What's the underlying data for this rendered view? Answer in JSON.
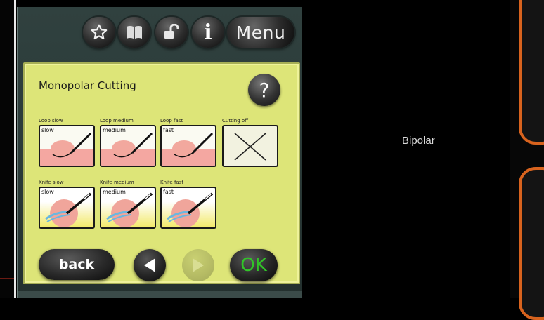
{
  "toolbar": {
    "menu_label": "Menu",
    "info_label": "i",
    "icons": [
      "star-icon",
      "book-icon",
      "unlock-icon",
      "info-icon"
    ]
  },
  "panel": {
    "title": "Monopolar Cutting",
    "help_label": "?",
    "modes": [
      {
        "label": "Loop slow",
        "tag": "slow",
        "icon": "loop-electrode-icon"
      },
      {
        "label": "Loop medium",
        "tag": "medium",
        "icon": "loop-electrode-icon"
      },
      {
        "label": "Loop fast",
        "tag": "fast",
        "icon": "loop-electrode-icon"
      },
      {
        "label": "Cutting off",
        "tag": "",
        "icon": "cross-icon"
      },
      {
        "label": "Knife slow",
        "tag": "slow",
        "icon": "knife-electrode-icon"
      },
      {
        "label": "Knife medium",
        "tag": "medium",
        "icon": "knife-electrode-icon"
      },
      {
        "label": "Knife fast",
        "tag": "fast",
        "icon": "knife-electrode-icon"
      }
    ],
    "back_label": "back",
    "ok_label": "OK"
  },
  "side": {
    "bipolar_label": "Bipolar"
  },
  "colors": {
    "panel": "#dde578",
    "ok_text": "#31c528",
    "accent_orange": "#d8631e"
  }
}
